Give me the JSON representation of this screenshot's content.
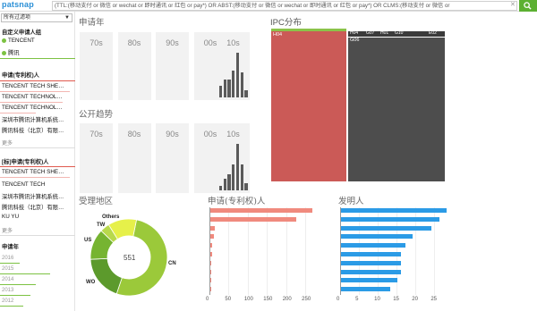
{
  "header": {
    "logo": "patsnap",
    "query": "(TTL:(移动支付 or 微信 or wechat or 即时通讯 or 红包 or pay*) OR ABST:(移动支付 or 微信 or wechat or 即时通讯 or 红包 or pay*) OR CLMS:(移动支付 or 微信 or",
    "clear_icon": "close-icon",
    "search_icon": "search-icon"
  },
  "sidebar": {
    "filter_label": "所有过滤项",
    "custom_group_title": "自定义申请人组",
    "custom_groups": [
      "TENCENT",
      "腾讯"
    ],
    "applicant_title": "申请(专利权)人",
    "applicants": [
      "TENCENT TECH SHE…",
      "TENCENT TECHNOL…",
      "TENCENT TECHNOL…",
      "深圳市腾讯计算机系统…",
      "腾讯科技（北京）有限…"
    ],
    "applicant_more": "更多",
    "current_applicant_title": "[标]申请(专利权)人",
    "current_applicants": [
      "TENCENT TECH SHE…",
      "TENCENT TECH",
      "深圳市腾讯计算机系统…",
      "腾讯科技（北京）有限…",
      "KU YU"
    ],
    "current_more": "更多",
    "year_title": "申请年",
    "years": [
      "2016",
      "2015",
      "2014",
      "2013",
      "2012"
    ],
    "colors": {
      "accent_green": "#7cc242",
      "underline_red": "#e05a4f"
    }
  },
  "app_year": {
    "title": "申请年",
    "decades": [
      "70s",
      "80s",
      "90s",
      "00s",
      "10s"
    ],
    "bars_10s": [
      0.25,
      0.4,
      0.4,
      0.6,
      1.0,
      0.55,
      0.15
    ]
  },
  "pub_trend": {
    "title": "公开趋势",
    "decades": [
      "70s",
      "80s",
      "90s",
      "00s",
      "10s"
    ],
    "bars_10s": [
      0.1,
      0.25,
      0.35,
      0.55,
      1.0,
      0.55,
      0.15
    ]
  },
  "ipc": {
    "title": "IPC分布",
    "blocks": [
      {
        "label": "H04",
        "color": "#cb5a57",
        "share": 0.43
      },
      {
        "label": "G06",
        "color": "#4d4d4d",
        "share": 0.57
      }
    ],
    "small_labels": [
      "H04",
      "G06",
      "H04",
      "G07",
      "H01",
      "G10",
      "E02"
    ]
  },
  "region": {
    "title": "受理地区",
    "total": "551",
    "segments": [
      {
        "label": "CN",
        "value": 0.52,
        "color": "#9bc93a"
      },
      {
        "label": "WO",
        "value": 0.19,
        "color": "#5c9a2c"
      },
      {
        "label": "US",
        "value": 0.13,
        "color": "#76b431"
      },
      {
        "label": "TW",
        "value": 0.04,
        "color": "#b8d94c"
      },
      {
        "label": "Others",
        "value": 0.12,
        "color": "#e6f04a"
      }
    ]
  },
  "applicant_chart": {
    "title": "申请(专利权)人",
    "color": "#f08a7e",
    "values": [
      265,
      225,
      12,
      9,
      5,
      4,
      3,
      3,
      2,
      2
    ],
    "ticks": [
      "0",
      "50",
      "100",
      "150",
      "200",
      "250"
    ],
    "max": 280
  },
  "inventor_chart": {
    "title": "发明人",
    "color": "#2b9be6",
    "values": [
      28,
      26,
      24,
      19,
      17,
      16,
      16,
      16,
      15,
      13
    ],
    "ticks": [
      "0",
      "5",
      "10",
      "15",
      "20",
      "25"
    ],
    "max": 28
  }
}
